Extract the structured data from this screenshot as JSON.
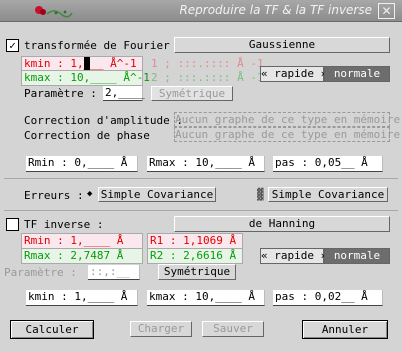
{
  "window": {
    "title": "Reproduire la TF & la TF inverse",
    "close": "✕"
  },
  "fourier": {
    "checkbox": "✓",
    "label": "transformée de Fourier :",
    "window_button": "Gaussienne",
    "kmin": "kmin : 1,",
    "kmin_rest": "__ Å^-1",
    "kmax": "kmax : 10,____ Å^-1",
    "ghost1": "1 ; :::.:::: Å -1",
    "ghost2": "2 ; :::.:::: Å -1",
    "param_label": "Paramètre :",
    "param_value": "2,____",
    "sym_button": "Symétrique",
    "rapide": "« rapide »",
    "normale": "normale",
    "corr_amp_label": "Correction d'amplitude :",
    "corr_amp_value": "Aucun graphe de ce type en mémoire",
    "corr_phase_label": "Correction de phase",
    "corr_phase_value": "Aucun graphe de ce type en mémoire",
    "rmin": "Rmin :   0,____ Å",
    "rmax": "Rmax :  10,____ Å",
    "pas": "pas : 0,05__ Å"
  },
  "errors": {
    "label": "Erreurs :",
    "diamond": "◆",
    "btn1": "Simple  Covariance",
    "glyph": "▓",
    "btn2": "Simple  Covariance"
  },
  "inverse": {
    "label": "TF inverse :",
    "window_button": "de Hanning",
    "rmin": "Rmin : 1,____ Å",
    "rmax": "Rmax : 2,7487 Å",
    "r1": "R1 : 1,1069 Å",
    "r2": "R2 : 2,6616 Å",
    "param_label": "Paramètre :",
    "param_value": "::,:__",
    "sym_button": "Symétrique",
    "rapide": "« rapide »",
    "normale": "normale",
    "kmin": "kmin :  1,____ Å",
    "kmax": "kmax : 10,____ Å",
    "pas": "pas : 0,02__ Å"
  },
  "actions": {
    "calc": "Calculer",
    "charger": "Charger",
    "sauver": "Sauver",
    "annuler": "Annuler"
  }
}
